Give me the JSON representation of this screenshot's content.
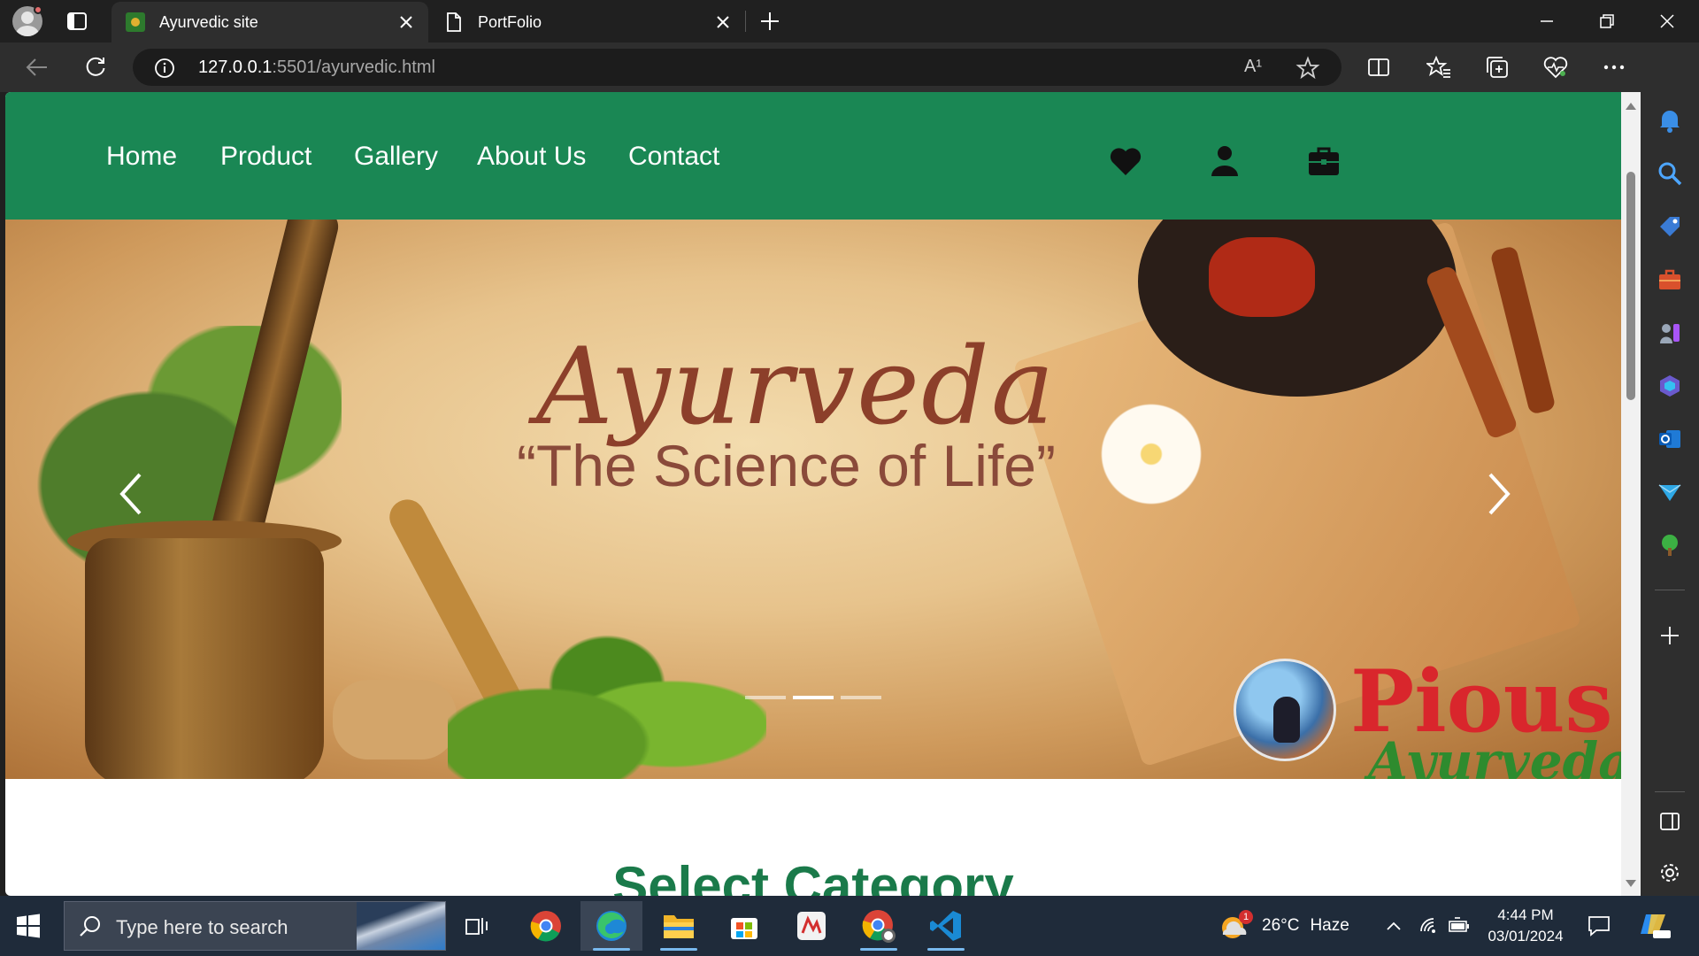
{
  "browser": {
    "tabs": [
      {
        "title": "Ayurvedic site",
        "active": true
      },
      {
        "title": "PortFolio",
        "active": false
      }
    ],
    "address": {
      "host": "127.0.0.1",
      "rest": ":5501/ayurvedic.html"
    },
    "read_aloud": "A¹"
  },
  "site": {
    "nav": {
      "links": [
        "Home",
        "Product",
        "Gallery",
        "About Us",
        "Contact"
      ],
      "icons": [
        "heart-icon",
        "user-icon",
        "briefcase-icon"
      ]
    },
    "hero": {
      "title": "Ayurveda",
      "subtitle": "“The Science of Life”",
      "logo_text": "Pious",
      "logo_sub": "Ayurveda",
      "slides": 3,
      "active_slide": 2
    },
    "section_heading": "Select Category"
  },
  "colors": {
    "nav_green": "#1a8754",
    "heading_green": "#1a7a4a",
    "title_brown": "#8c3f2a"
  },
  "taskbar": {
    "search_placeholder": "Type here to search",
    "weather_temp": "26°C",
    "weather_desc": "Haze",
    "weather_badge": "1",
    "time": "4:44 PM",
    "date": "03/01/2024"
  }
}
